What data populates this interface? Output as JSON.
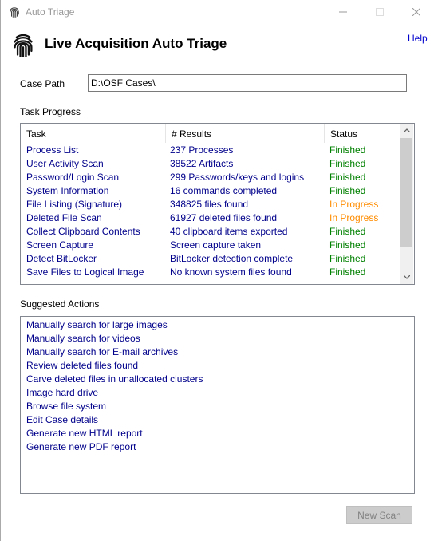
{
  "window": {
    "title": "Auto Triage",
    "app_title": "Live Acquisition Auto Triage",
    "help_label": "Help",
    "icon": "fingerprint-icon"
  },
  "case_path": {
    "label": "Case Path",
    "value": "D:\\OSF Cases\\"
  },
  "task_progress": {
    "label": "Task Progress",
    "columns": [
      "Task",
      "# Results",
      "Status"
    ],
    "status_colors": {
      "Finished": "#008000",
      "In Progress": "#ff8c00"
    },
    "rows": [
      {
        "task": "Process List",
        "results": "237 Processes",
        "status": "Finished"
      },
      {
        "task": "User Activity Scan",
        "results": "38522 Artifacts",
        "status": "Finished"
      },
      {
        "task": "Password/Login Scan",
        "results": "299 Passwords/keys and logins",
        "status": "Finished"
      },
      {
        "task": "System Information",
        "results": "16 commands completed",
        "status": "Finished"
      },
      {
        "task": "File Listing (Signature)",
        "results": "348825 files found",
        "status": "In Progress"
      },
      {
        "task": "Deleted File Scan",
        "results": "61927 deleted files found",
        "status": "In Progress"
      },
      {
        "task": "Collect Clipboard Contents",
        "results": "40 clipboard items exported",
        "status": "Finished"
      },
      {
        "task": "Screen Capture",
        "results": "Screen capture taken",
        "status": "Finished"
      },
      {
        "task": "Detect BitLocker",
        "results": "BitLocker detection complete",
        "status": "Finished"
      },
      {
        "task": "Save Files to Logical Image",
        "results": "No known system files found",
        "status": "Finished"
      }
    ]
  },
  "suggested_actions": {
    "label": "Suggested Actions",
    "items": [
      "Manually search for large images",
      "Manually search for videos",
      "Manually search for E-mail archives",
      "Review deleted files found",
      "Carve deleted files in unallocated clusters",
      "Image hard drive",
      "Browse file system",
      "Edit Case details",
      "Generate new HTML report",
      "Generate new PDF report"
    ]
  },
  "buttons": {
    "new_scan": "New Scan"
  }
}
